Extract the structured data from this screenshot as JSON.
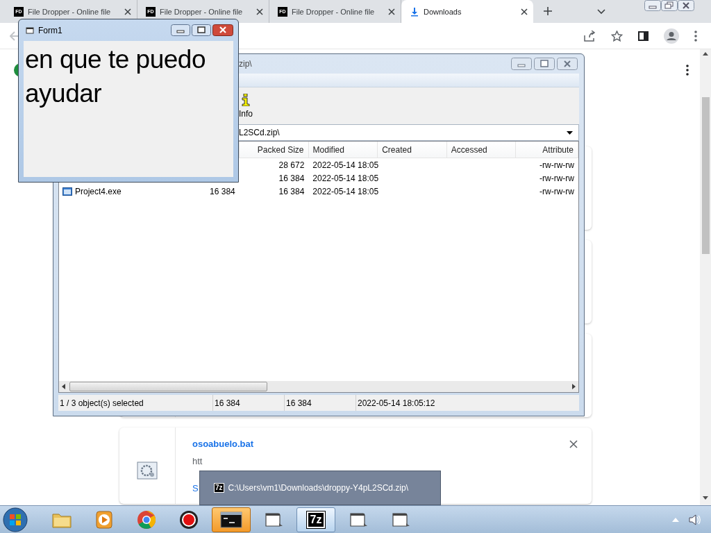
{
  "browser": {
    "tabs": [
      {
        "kind": "site",
        "favicon": "FD",
        "label": "File Dropper - Online file",
        "selected": false
      },
      {
        "kind": "site",
        "favicon": "FD",
        "label": "File Dropper - Online file",
        "selected": false
      },
      {
        "kind": "site",
        "favicon": "FD",
        "label": "File Dropper - Online file",
        "selected": false
      },
      {
        "kind": "downloads",
        "label": "Downloads",
        "selected": true
      }
    ]
  },
  "downloads": {
    "cards": [
      {
        "kind": "hidden"
      },
      {
        "kind": "hidden"
      },
      {
        "kind": "hidden"
      },
      {
        "kind": "file",
        "name": "osoabuelo.bat",
        "url": "htt",
        "link": "S"
      }
    ]
  },
  "archive_window": {
    "title": "zip\\",
    "toolbar": [
      {
        "label": "Info"
      }
    ],
    "path": "L2SCd.zip\\",
    "columns": [
      {
        "label": "Packed Size"
      },
      {
        "label": "Modified"
      },
      {
        "label": "Created"
      },
      {
        "label": "Accessed"
      },
      {
        "label": "Attribute"
      }
    ],
    "rows": [
      {
        "packed": "28 672",
        "modified": "2022-05-14 18:05",
        "attributes": "-rw-rw-rw"
      },
      {
        "packed": "16 384",
        "modified": "2022-05-14 18:05",
        "attributes": "-rw-rw-rw"
      },
      {
        "name": "Project4.exe",
        "size": "16 384",
        "packed": "16 384",
        "modified": "2022-05-14 18:05",
        "attributes": "-rw-rw-rw"
      }
    ],
    "status": [
      "1 / 3 object(s) selected",
      "16 384",
      "16 384",
      "2022-05-14 18:05:12"
    ]
  },
  "form_window": {
    "title": "Form1",
    "text": "en que te puedo ayudar"
  },
  "tooltip": {
    "icon": "7z",
    "text": "C:\\Users\\vm1\\Downloads\\droppy-Y4pL2SCd.zip\\"
  },
  "taskbar": {
    "items": [
      {
        "kind": "start",
        "highlighted": false,
        "selected": false
      },
      {
        "kind": "explorer",
        "highlighted": false,
        "selected": false
      },
      {
        "kind": "media",
        "highlighted": false,
        "selected": false
      },
      {
        "kind": "chrome",
        "highlighted": false,
        "selected": false
      },
      {
        "kind": "recorder",
        "highlighted": false,
        "selected": false
      },
      {
        "kind": "console",
        "highlighted": true,
        "selected": false
      },
      {
        "kind": "folder",
        "highlighted": false,
        "selected": false
      },
      {
        "kind": "archiver",
        "label": "7z",
        "highlighted": false,
        "selected": true
      },
      {
        "kind": "folder",
        "highlighted": false,
        "selected": false
      },
      {
        "kind": "folder",
        "highlighted": false,
        "selected": false
      }
    ]
  }
}
